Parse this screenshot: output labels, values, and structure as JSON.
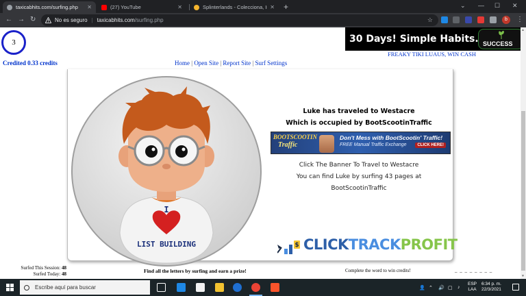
{
  "browser": {
    "tabs": [
      {
        "title": "taxicabhits.com/surfing.php",
        "active": true,
        "favicon_color": "#9aa0a6"
      },
      {
        "title": "(27) YouTube",
        "active": false,
        "favicon_color": "#ff0000"
      },
      {
        "title": "Splinterlands - Colecciona, Interca",
        "active": false,
        "favicon_color": "#f5b52e"
      }
    ],
    "address": {
      "security_label": "No es seguro",
      "host": "taxicabhits.com",
      "path": "/surfing.php"
    },
    "profile_initial": "b"
  },
  "page": {
    "timer_value": "3",
    "credited_text": "Credited 0.33 credits",
    "nav_links": [
      "Home",
      "Open Site",
      "Report Site",
      "Surf Settings"
    ],
    "top_ad": {
      "text": "30 Days! Simple Habits...!",
      "logo_text": "SUCCESS"
    },
    "tiki_link": "FREAKY TIKI LUAUS, WIN CASH",
    "avatar": {
      "shirt_letter": "I",
      "shirt_text": "LIST BUILDING"
    },
    "travel": {
      "line1": "Luke has traveled to Westacre",
      "line2": "Which is occupied by BootScootinTraffic",
      "click_banner": "Click The Banner To Travel to Westacre",
      "find_line": "You can find Luke by surfing 43 pages at",
      "site_name": "BootScootinTraffic"
    },
    "banner": {
      "brand_top": "BOOTSCOOTIN",
      "brand_bottom": "Traffic",
      "slogan": "Don't Mess with BootScootin' Traffic!",
      "sub": "FREE Manual Traffic Exchange",
      "cta": "CLICK HERE!"
    },
    "ctp_logo": {
      "part1": "CLICK",
      "part2": "TRACK",
      "part3": "PROFIT"
    },
    "footer": {
      "session_label": "Surfed This Session:",
      "session_value": "48",
      "today_label": "Surfed Today:",
      "today_value": "48",
      "find_letters": "Find all the letters by surfing and earn a prize!",
      "complete_word": "Complete the word to win credits!",
      "word_blanks": "_ _ _ _   _ _ _ _"
    }
  },
  "taskbar": {
    "search_placeholder": "Escribe aquí para buscar",
    "lang_top": "ESP",
    "lang_bottom": "LAA",
    "time": "6:34 p. m.",
    "date": "22/3/2021"
  },
  "colors": {
    "link_blue": "#0033cc",
    "timer_ring": "#1a21c9",
    "chrome_dark": "#202124",
    "taskbar_bg": "#1b2428"
  }
}
